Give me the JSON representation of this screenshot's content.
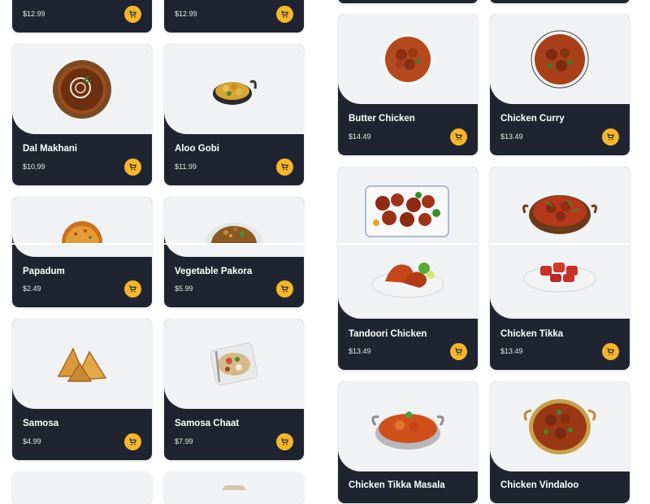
{
  "left_column": [
    {
      "id": "l0",
      "name": "",
      "price": "$12.99"
    },
    {
      "id": "l1",
      "name": "",
      "price": "$12.99"
    },
    {
      "id": "l2",
      "name": "Dal Makhani",
      "price": "$10,99"
    },
    {
      "id": "l3",
      "name": "Aloo Gobi",
      "price": "$11.99"
    },
    {
      "id": "l4",
      "name": "Papadum",
      "price": "$2.49"
    },
    {
      "id": "l5",
      "name": "Vegetable Pakora",
      "price": "$5.99"
    },
    {
      "id": "l6",
      "name": "Samosa",
      "price": "$4.99"
    },
    {
      "id": "l7",
      "name": "Samosa Chaat",
      "price": "$7.99"
    }
  ],
  "right_column": [
    {
      "id": "r0",
      "name": "Butter Chicken",
      "price": "$14.49"
    },
    {
      "id": "r1",
      "name": "Chicken Curry",
      "price": "$13.49"
    },
    {
      "id": "r2",
      "name": "Tandoori Chicken",
      "price": "$13.49"
    },
    {
      "id": "r3",
      "name": "Chicken Tikka",
      "price": "$13.49"
    },
    {
      "id": "r4",
      "name": "Chicken Tikka Masala",
      "price": ""
    },
    {
      "id": "r5",
      "name": "Chicken Vindaloo",
      "price": ""
    }
  ],
  "icons": {
    "cart": "cart-icon"
  },
  "colors": {
    "card_bg": "#1f2430",
    "image_bg": "#f1f2f4",
    "cart_button": "#f6b62b"
  }
}
